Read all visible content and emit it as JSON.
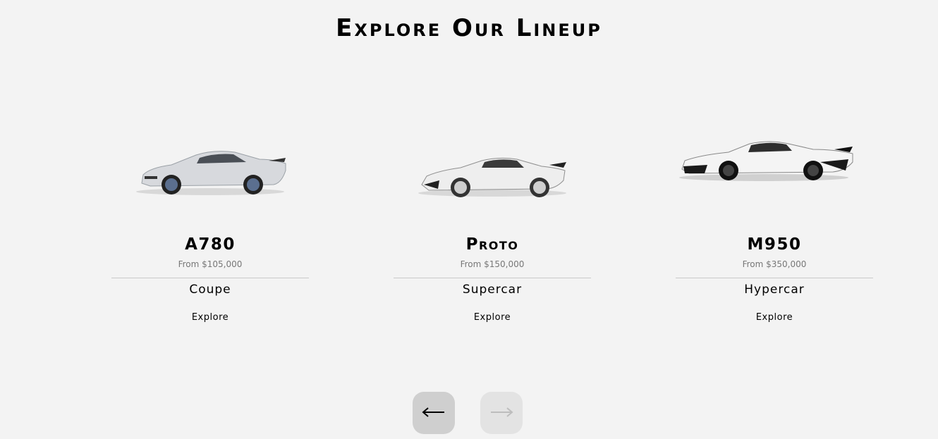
{
  "header": {
    "title": "Explore Our Lineup"
  },
  "cars": [
    {
      "name": "A780",
      "price": "From $105,000",
      "category": "Coupe",
      "cta": "Explore",
      "image_icon": "coupe-car-image",
      "body_color": "#d7d9dd"
    },
    {
      "name": "Proto",
      "price": "From $150,000",
      "category": "Supercar",
      "cta": "Explore",
      "image_icon": "supercar-image",
      "body_color": "#eeeeee"
    },
    {
      "name": "M950",
      "price": "From $350,000",
      "category": "Hypercar",
      "cta": "Explore",
      "image_icon": "hypercar-image",
      "body_color": "#f4f4f4"
    }
  ],
  "carousel": {
    "prev_icon": "arrow-left-icon",
    "next_icon": "arrow-right-icon",
    "prev_enabled": true,
    "next_enabled": false
  }
}
